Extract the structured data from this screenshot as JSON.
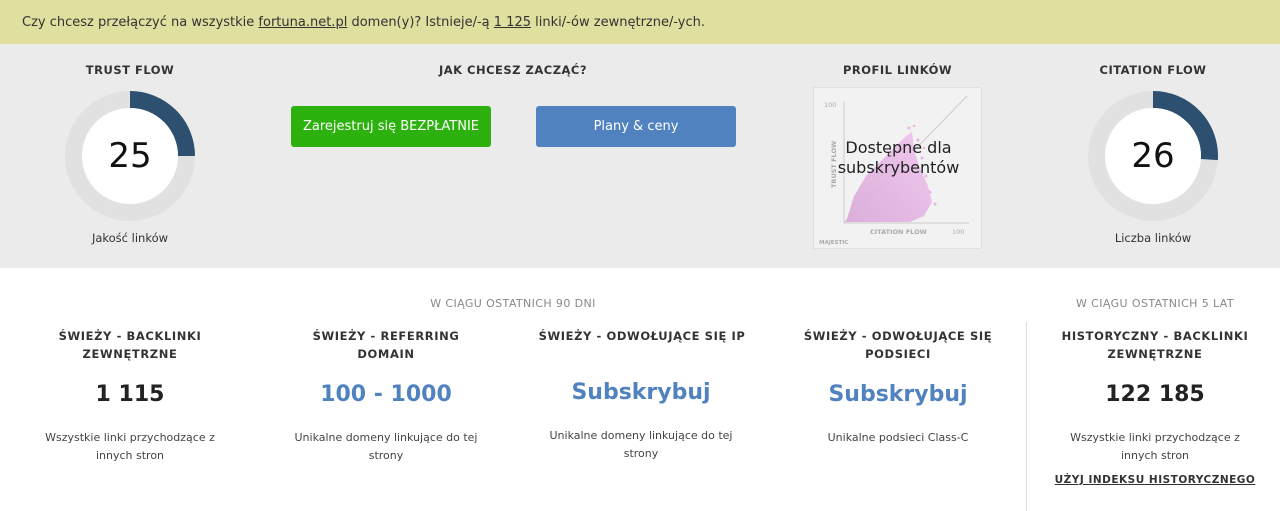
{
  "banner": {
    "prefix": "Czy chcesz przełączyć na wszystkie",
    "domain": "fortuna.net.pl",
    "middle": "domen(y)? Istnieje/-ą",
    "count": "1 125",
    "suffix": "linki/-ów zewnętrzne/-ych."
  },
  "trust_flow": {
    "title": "TRUST FLOW",
    "value": "25",
    "fraction": 0.25,
    "caption": "Jakość linków"
  },
  "start": {
    "title": "JAK CHCESZ ZACZĄĆ?",
    "register_label": "Zarejestruj się BEZPŁATNIE",
    "plans_label": "Plany & ceny"
  },
  "profile": {
    "title": "PROFIL LINKÓW",
    "overlay_line1": "Dostępne dla",
    "overlay_line2": "subskrybentów",
    "axis_y": "TRUST FLOW",
    "axis_x": "CITATION FLOW",
    "tick_100_y": "100",
    "tick_100_x": "100",
    "watermark": "MAJESTIC"
  },
  "citation_flow": {
    "title": "CITATION FLOW",
    "value": "26",
    "fraction": 0.26,
    "caption": "Liczba linków"
  },
  "periods": {
    "recent": "W CIĄGU OSTATNICH 90 DNI",
    "historic": "W CIĄGU OSTATNICH 5 LAT"
  },
  "stats": [
    {
      "title": "ŚWIEŻY - BACKLINKI ZEWNĘTRZNE",
      "value": "1 115",
      "desc": "Wszystkie linki przychodzące z innych stron"
    },
    {
      "title": "ŚWIEŻY - REFERRING DOMAIN",
      "value": "100 - 1000",
      "desc": "Unikalne domeny linkujące do tej strony"
    },
    {
      "title": "ŚWIEŻY - ODWOŁUJĄCE SIĘ IP",
      "value": "Subskrybuj",
      "desc": "Unikalne domeny linkujące do tej strony"
    },
    {
      "title": "ŚWIEŻY - ODWOŁUJĄCE SIĘ PODSIECI",
      "value": "Subskrybuj",
      "desc": "Unikalne podsieci Class-C"
    },
    {
      "title": "HISTORYCZNY - BACKLINKI ZEWNĘTRZNE",
      "value": "122 185",
      "desc": "Wszystkie linki przychodzące z innych stron"
    }
  ],
  "historic_link": "UŻYJ INDEKSU HISTORYCZNEGO",
  "colors": {
    "gauge_fill": "#2d5070",
    "gauge_track": "#e1e1e1",
    "green": "#2cb10e",
    "blue": "#5182c0"
  }
}
